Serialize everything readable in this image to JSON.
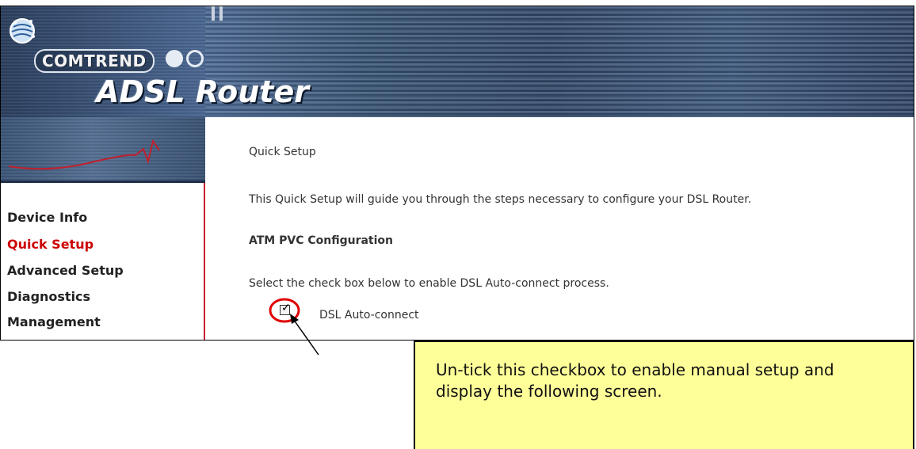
{
  "header": {
    "brand": "COMTREND",
    "product": "ADSL Router"
  },
  "sidebar": {
    "items": [
      {
        "label": "Device Info",
        "active": false
      },
      {
        "label": "Quick Setup",
        "active": true
      },
      {
        "label": "Advanced Setup",
        "active": false
      },
      {
        "label": "Diagnostics",
        "active": false
      },
      {
        "label": "Management",
        "active": false
      }
    ]
  },
  "main": {
    "title": "Quick Setup",
    "intro": "This Quick Setup will guide you through the steps necessary to configure your DSL Router.",
    "section_heading": "ATM PVC Configuration",
    "instruction": "Select the check box below to enable DSL Auto-connect process.",
    "checkbox_label": "DSL Auto-connect",
    "checkbox_checked": true
  },
  "callout": {
    "text_line1": "Un-tick this checkbox to enable manual setup and",
    "text_line2": "display the following screen."
  },
  "colors": {
    "active_nav": "#cc0000",
    "highlight_circle": "#e00000",
    "callout_bg": "#ffff99"
  }
}
